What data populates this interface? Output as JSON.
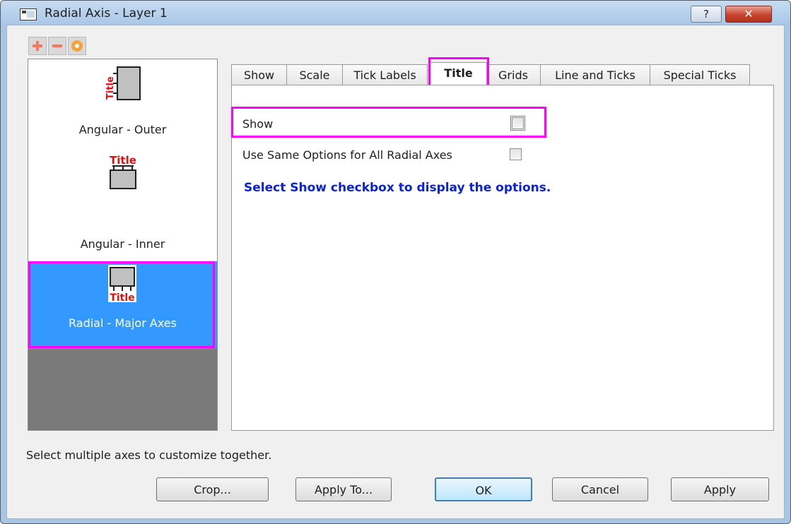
{
  "window": {
    "title": "Radial Axis - Layer 1",
    "help_glyph": "?",
    "close_glyph": "✕"
  },
  "toolbar": {
    "add_icon": "plus-icon",
    "remove_icon": "minus-icon",
    "settings_icon": "gear-icon"
  },
  "axes": {
    "icon_text": "Title",
    "items": [
      {
        "label": "Angular - Outer",
        "selected": false
      },
      {
        "label": "Angular - Inner",
        "selected": false
      },
      {
        "label": "Radial - Major Axes",
        "selected": true
      }
    ]
  },
  "tabs": [
    {
      "label": "Show",
      "active": false
    },
    {
      "label": "Scale",
      "active": false
    },
    {
      "label": "Tick Labels",
      "active": false
    },
    {
      "label": "Title",
      "active": true
    },
    {
      "label": "Grids",
      "active": false
    },
    {
      "label": "Line and Ticks",
      "active": false
    },
    {
      "label": "Special Ticks",
      "active": false
    }
  ],
  "panel": {
    "show_label": "Show",
    "show_checked": false,
    "same_options_label": "Use Same Options for All Radial Axes",
    "same_options_checked": false,
    "note": "Select Show checkbox to display the options."
  },
  "footer": {
    "hint": "Select multiple axes to customize together.",
    "buttons": {
      "crop": "Crop...",
      "apply_to": "Apply To...",
      "ok": "OK",
      "cancel": "Cancel",
      "apply": "Apply"
    }
  },
  "colors": {
    "highlight": "#ff00ff",
    "selection": "#3399ff",
    "note_text": "#0a22d6",
    "title_red": "#e01010"
  }
}
